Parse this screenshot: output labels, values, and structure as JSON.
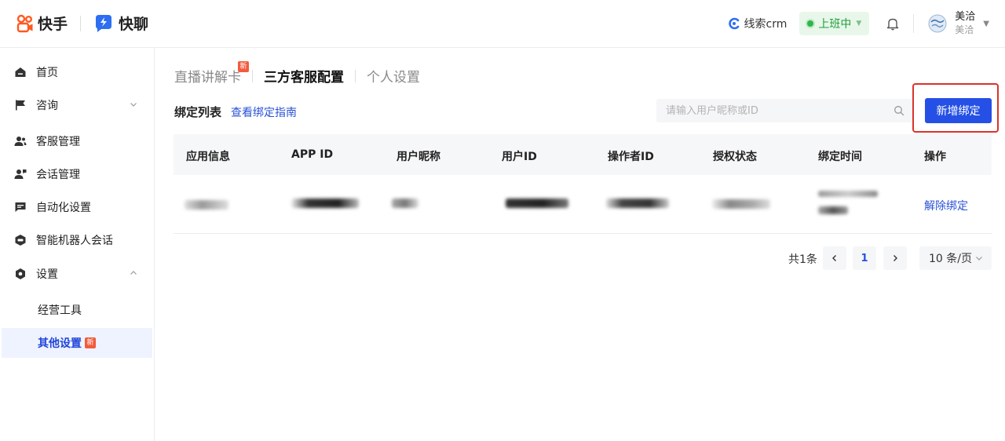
{
  "header": {
    "brand_kuaishou": "快手",
    "brand_kuailiao": "快聊",
    "crm_label": "线索crm",
    "duty_status": "上班中",
    "user_name": "美洽",
    "user_sub": "美洽"
  },
  "sidebar": {
    "items": [
      {
        "label": "首页",
        "icon": "home-icon"
      },
      {
        "label": "咨询",
        "icon": "flag-icon"
      },
      {
        "label": "客服管理",
        "icon": "users-icon"
      },
      {
        "label": "会话管理",
        "icon": "user-chat-icon"
      },
      {
        "label": "自动化设置",
        "icon": "message-icon"
      },
      {
        "label": "智能机器人会话",
        "icon": "robot-icon"
      },
      {
        "label": "设置",
        "icon": "settings-icon"
      }
    ],
    "sub_items": [
      {
        "label": "经营工具"
      },
      {
        "label": "其他设置",
        "badge": "新"
      }
    ]
  },
  "tabs": [
    {
      "label": "直播讲解卡",
      "badge": "新"
    },
    {
      "label": "三方客服配置"
    },
    {
      "label": "个人设置"
    }
  ],
  "list": {
    "title": "绑定列表",
    "guide_link": "查看绑定指南",
    "search_placeholder": "请输入用户昵称或ID",
    "add_button": "新增绑定"
  },
  "table": {
    "columns": [
      "应用信息",
      "APP ID",
      "用户昵称",
      "用户ID",
      "操作者ID",
      "授权状态",
      "绑定时间",
      "操作"
    ],
    "rows": [
      {
        "action": "解除绑定"
      }
    ]
  },
  "pagination": {
    "total": "共1条",
    "current_page": "1",
    "page_size": "10 条/页"
  },
  "colors": {
    "primary": "#2550e6",
    "link": "#2a52d6",
    "duty_green": "#1f9d3a",
    "badge_red": "#f25b3c",
    "highlight_red": "#d9342b"
  }
}
